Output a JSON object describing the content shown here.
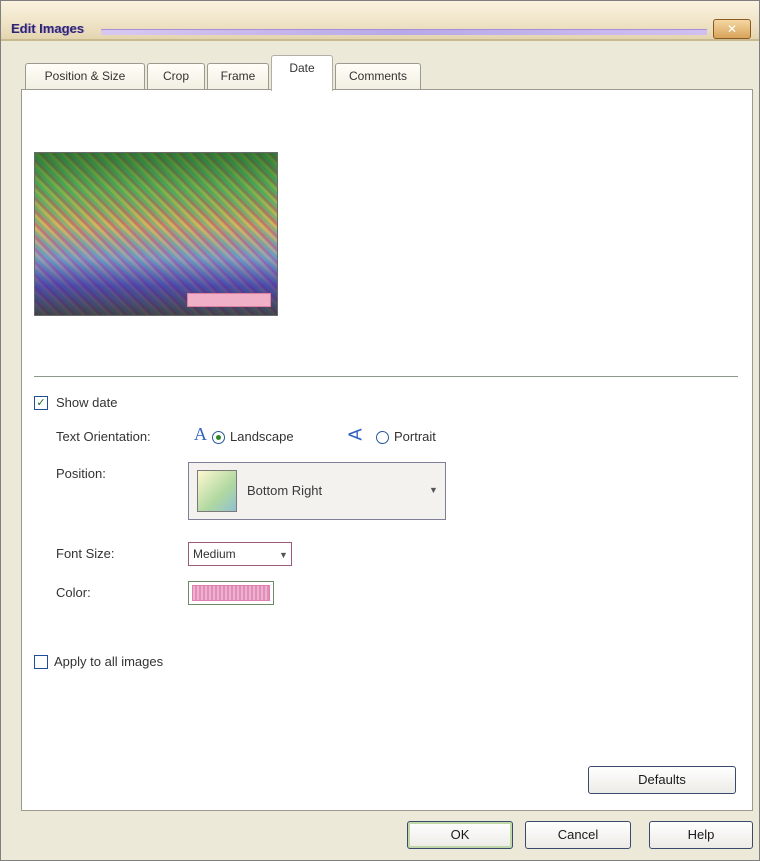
{
  "window": {
    "title": "Edit Images",
    "close_label": "✕"
  },
  "tabs": [
    {
      "label": "Position & Size"
    },
    {
      "label": "Crop"
    },
    {
      "label": "Frame"
    },
    {
      "label": "Date"
    },
    {
      "label": "Comments"
    }
  ],
  "active_tab": "Date",
  "date_panel": {
    "show_date": {
      "label": "Show date",
      "checked": true
    },
    "text_orientation": {
      "label": "Text Orientation:",
      "landscape_label": "Landscape",
      "portrait_label": "Portrait",
      "selected": "Landscape"
    },
    "position": {
      "label": "Position:",
      "value": "Bottom Right"
    },
    "font_size": {
      "label": "Font Size:",
      "value": "Medium"
    },
    "color": {
      "label": "Color:",
      "value": "#f0b0d0"
    },
    "apply_all": {
      "label": "Apply to all images",
      "checked": false
    },
    "defaults_label": "Defaults"
  },
  "footer": {
    "ok_label": "OK",
    "cancel_label": "Cancel",
    "help_label": "Help"
  },
  "icons": {
    "landscape": "letter-a-icon",
    "portrait": "rotated-letter-icon"
  }
}
